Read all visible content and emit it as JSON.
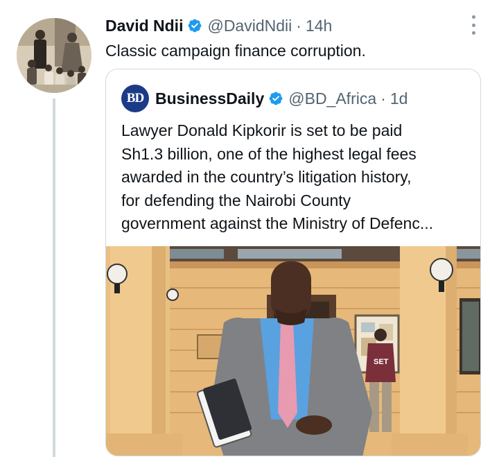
{
  "tweet": {
    "author_name": "David Ndii",
    "handle": "@DavidNdii",
    "separator": "·",
    "time": "14h",
    "text": "Classic campaign finance corruption."
  },
  "quoted_tweet": {
    "logo_text": "BD",
    "author_name": "BusinessDaily",
    "handle": "@BD_Africa",
    "separator": "·",
    "time": "1d",
    "text_lines": [
      "Lawyer Donald Kipkorir is set to be paid",
      "Sh1.3 billion, one of the highest legal fees",
      "awarded in the country’s litigation history,",
      "for defending the Nairobi County",
      "government against the Ministry of Defenc..."
    ],
    "photo_shirt_text": "SET"
  },
  "icons": {
    "verified": "verified-badge-icon",
    "more": "more-options-icon"
  },
  "colors": {
    "verified_blue": "#1d9bf0",
    "muted": "#536471",
    "logo_blue": "#1c3b87"
  }
}
